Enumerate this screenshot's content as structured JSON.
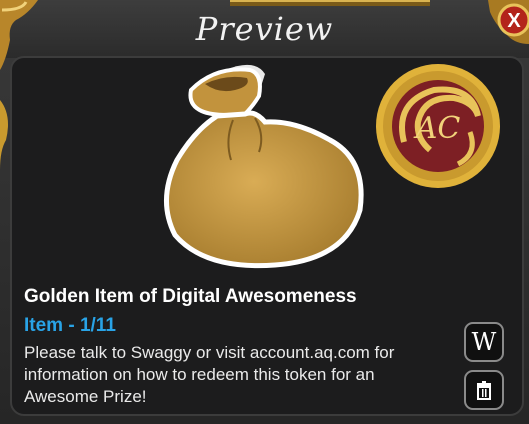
{
  "window": {
    "title": "Preview",
    "close_label": "X"
  },
  "item": {
    "name": "Golden Item of Digital Awesomeness",
    "type_line": "Item - 1/11",
    "description": "Please talk to Swaggy or visit account.aq.com for information on how to redeem this token for an Awesome Prize!",
    "image_icon": "bag-icon",
    "badge_icon": "ac-coin-icon",
    "badge_text": "AC"
  },
  "buttons": {
    "wiki_label": "W",
    "trash_icon": "trash-icon"
  },
  "colors": {
    "item_type": "#29a3e6",
    "gold": "#c99a2e",
    "close_red": "#b3241b"
  }
}
